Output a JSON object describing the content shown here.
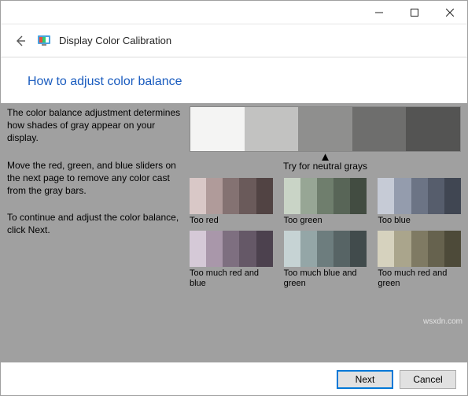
{
  "window": {
    "app_title": "Display Color Calibration"
  },
  "page": {
    "heading": "How to adjust color balance",
    "para1": "The color balance adjustment determines how shades of gray appear on your display.",
    "para2": "Move the red, green, and blue sliders on the next page to remove any color cast from the gray bars.",
    "para3": "To continue and adjust the color balance, click Next.",
    "neutral_hint": "Try for neutral grays",
    "neutral_swatches": [
      "#F4F4F3",
      "#C2C2C1",
      "#8F8F8E",
      "#6E6E6D",
      "#545453"
    ],
    "casts": [
      {
        "label": "Too red",
        "colors": [
          "#D9C8C7",
          "#B09B9A",
          "#847272",
          "#6A5A5A",
          "#514343"
        ]
      },
      {
        "label": "Too green",
        "colors": [
          "#C9D4C6",
          "#97A695",
          "#6F7E6D",
          "#586557",
          "#424C41"
        ]
      },
      {
        "label": "Too blue",
        "colors": [
          "#C6CBD6",
          "#949CAD",
          "#6C7485",
          "#565D6C",
          "#404652"
        ]
      },
      {
        "label": "Too much red and blue",
        "colors": [
          "#D5C9D7",
          "#A997AA",
          "#7E6F80",
          "#655867",
          "#4C414E"
        ]
      },
      {
        "label": "Too much blue and green",
        "colors": [
          "#C6D3D4",
          "#94A6A7",
          "#6D7D7E",
          "#576465",
          "#414B4C"
        ]
      },
      {
        "label": "Too much red and green",
        "colors": [
          "#D6D2BE",
          "#AAA58C",
          "#7F7A63",
          "#66624E",
          "#4D4A39"
        ]
      }
    ]
  },
  "footer": {
    "next_label": "Next",
    "cancel_label": "Cancel"
  },
  "watermark": "wsxdn.com"
}
